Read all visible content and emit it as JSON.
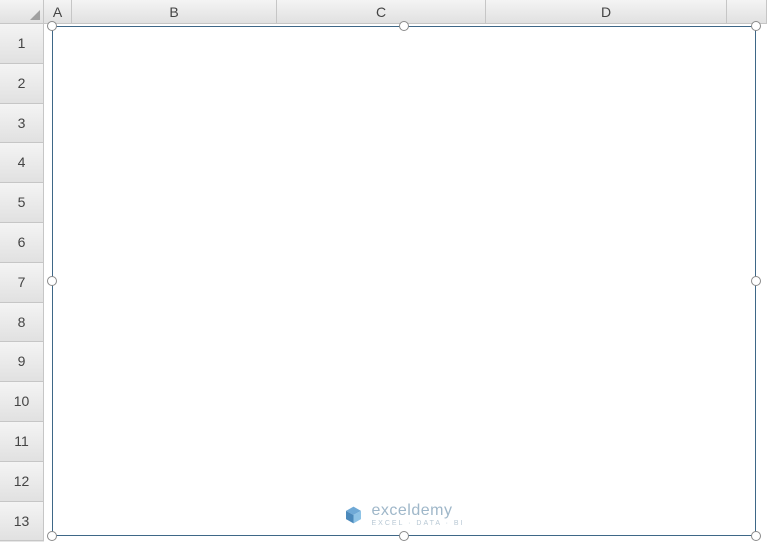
{
  "columns": [
    "A",
    "B",
    "C",
    "D",
    ""
  ],
  "rows": [
    "1",
    "2",
    "3",
    "4",
    "5",
    "6",
    "7",
    "8",
    "9",
    "10",
    "11",
    "12",
    "13"
  ],
  "watermark": {
    "main": "exceldemy",
    "sub": "EXCEL · DATA · BI"
  }
}
